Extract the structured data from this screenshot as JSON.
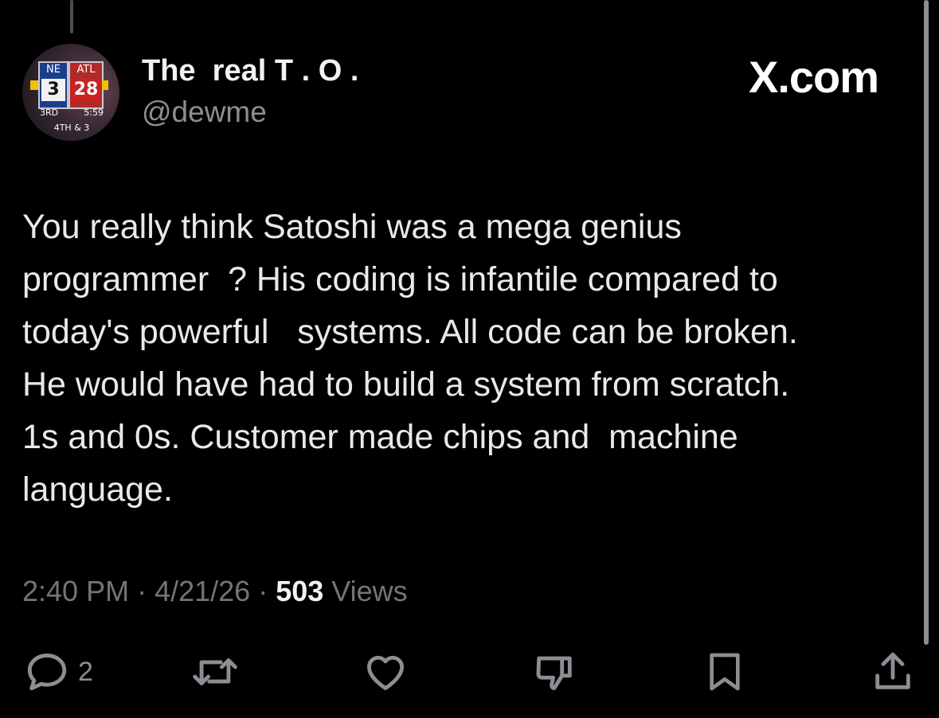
{
  "author": {
    "display_name": "The  real T . O .",
    "handle": "@dewme",
    "avatar": {
      "team_left": "NE",
      "score_left": "3",
      "team_right": "ATL",
      "score_right": "28",
      "quarter": "3RD",
      "clock": "5:59",
      "down": "4TH & 3"
    }
  },
  "watermark": "X.com",
  "tweet": {
    "text": "You really think Satoshi was a mega genius\nprogrammer  ? His coding is infantile compared to\ntoday's powerful   systems. All code can be broken.\nHe would have had to build a system from scratch.\n1s and 0s. Customer made chips and  machine\nlanguage.",
    "time": "2:40 PM",
    "date": "4/21/26",
    "views_count": "503",
    "views_label": "Views"
  },
  "actions": {
    "reply_count": "2",
    "icons": [
      "reply-icon",
      "repost-icon",
      "like-icon",
      "dislike-icon",
      "bookmark-icon",
      "share-icon"
    ]
  },
  "colors": {
    "background": "#000000",
    "text": "#e7e9ea",
    "secondary": "#71767b"
  }
}
